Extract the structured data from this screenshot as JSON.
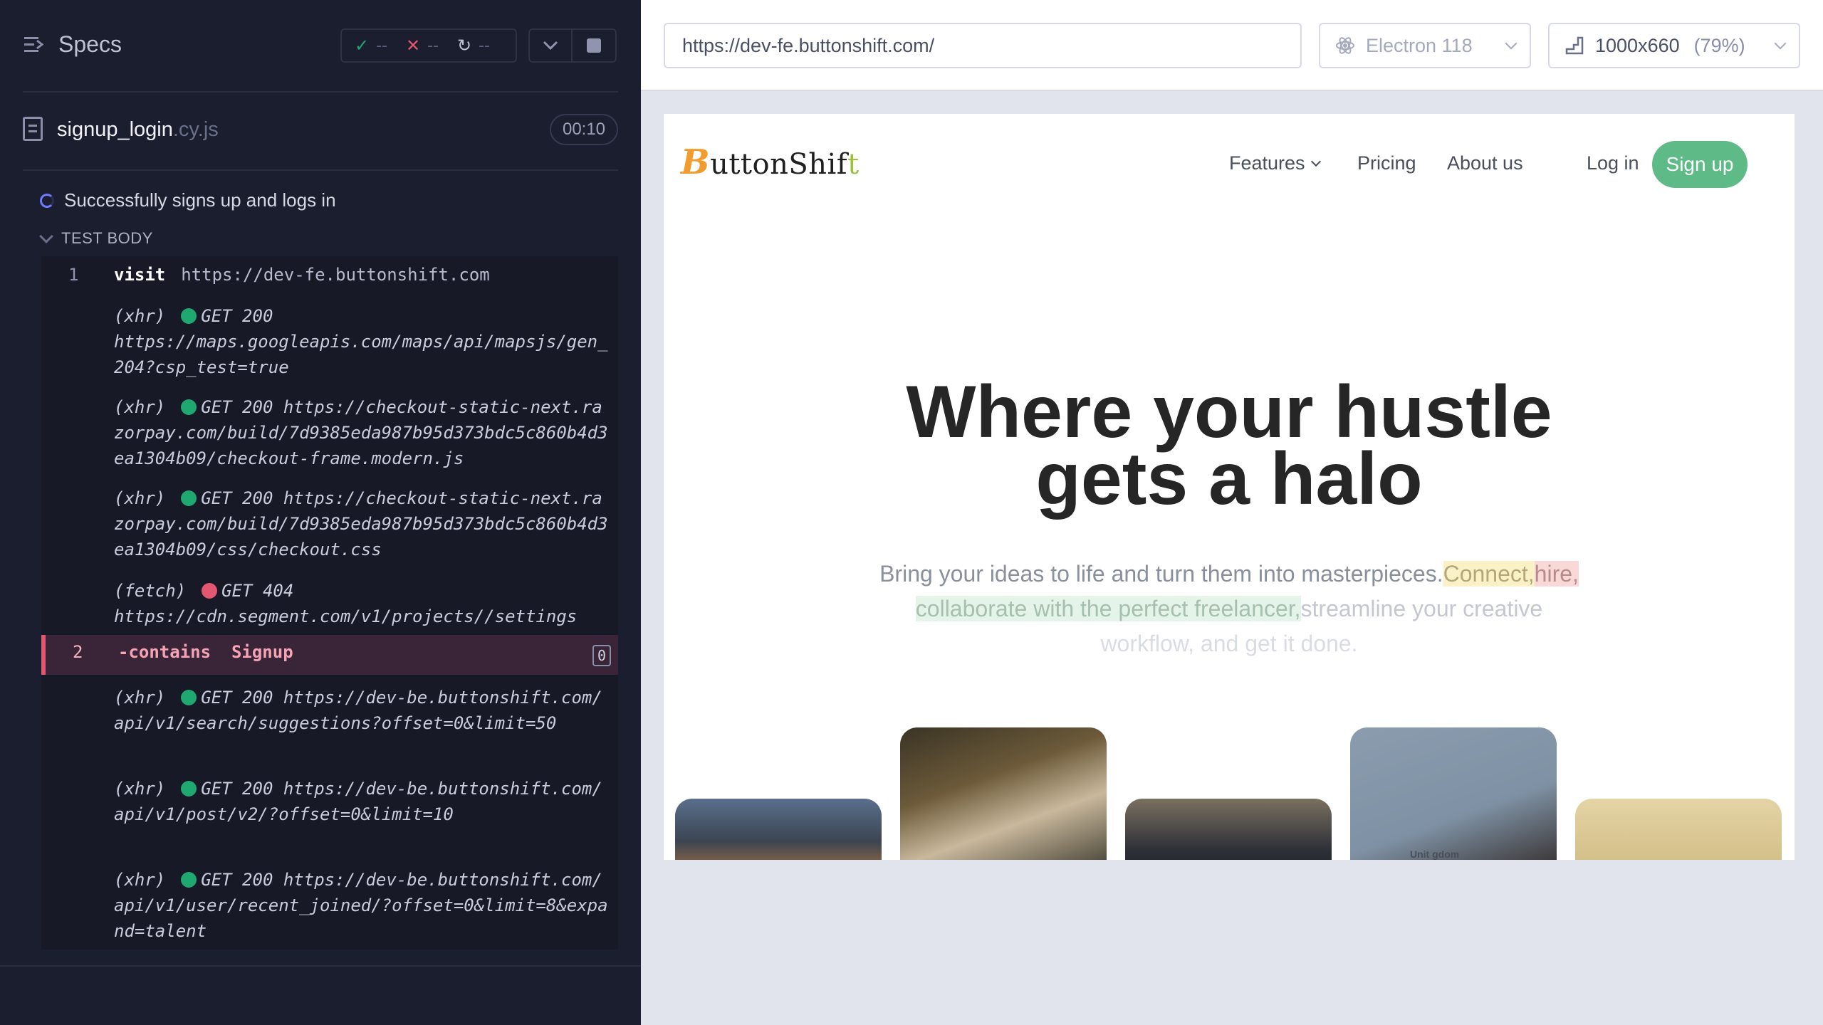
{
  "reporter": {
    "specs_label": "Specs",
    "stats": {
      "passed": "--",
      "failed": "--",
      "pending": "--"
    },
    "spec_file": {
      "name": "signup_login",
      "ext": ".cy.js",
      "duration": "00:10"
    },
    "test_title": "Successfully signs up and logs in",
    "test_body_label": "TEST BODY",
    "commands": [
      {
        "num": "1",
        "name": "visit",
        "arg": "https://dev-fe.buttonshift.com"
      },
      {
        "num": "2",
        "name": "-contains",
        "arg": "Signup",
        "count": "0"
      }
    ],
    "requests": [
      {
        "kind": "(xhr)",
        "status": "ok",
        "method": "GET 200",
        "url": "https://maps.googleapis.com/maps/api/mapsjs/gen_204?csp_test=true"
      },
      {
        "kind": "(xhr)",
        "status": "ok",
        "method": "GET 200",
        "url": "https://checkout-static-next.razorpay.com/build/7d9385eda987b95d373bdc5c860b4d3ea1304b09/checkout-frame.modern.js"
      },
      {
        "kind": "(xhr)",
        "status": "ok",
        "method": "GET 200",
        "url": "https://checkout-static-next.razorpay.com/build/7d9385eda987b95d373bdc5c860b4d3ea1304b09/css/checkout.css"
      },
      {
        "kind": "(fetch)",
        "status": "err",
        "method": "GET 404",
        "url": "https://cdn.segment.com/v1/projects//settings"
      },
      {
        "kind": "(xhr)",
        "status": "ok",
        "method": "GET 200",
        "url": "https://dev-be.buttonshift.com/api/v1/search/suggestions?offset=0&limit=50"
      },
      {
        "kind": "(xhr)",
        "status": "ok",
        "method": "GET 200",
        "url": "https://dev-be.buttonshift.com/api/v1/post/v2/?offset=0&limit=10"
      },
      {
        "kind": "(xhr)",
        "status": "ok",
        "method": "GET 200",
        "url": "https://dev-be.buttonshift.com/api/v1/user/recent_joined/?offset=0&limit=8&expand=talent"
      }
    ]
  },
  "aut": {
    "url": "https://dev-fe.buttonshift.com/",
    "browser": "Electron 118",
    "viewport": "1000x660",
    "scale": "(79%)",
    "site": {
      "logo_b": "B",
      "logo_rest": "uttonShif",
      "logo_t": "t",
      "nav": {
        "features": "Features",
        "pricing": "Pricing",
        "about": "About us",
        "login": "Log in",
        "signup": "Sign up"
      },
      "hero_title_line1": "Where your hustle",
      "hero_title_line2": "gets a halo",
      "hero_sub": {
        "part1": "Bring your ideas to life and turn them into masterpieces.",
        "connect": "Connect,",
        "hire": "hire,",
        "collab": "collaborate with the perfect freelancer,",
        "part2": "streamline your creative",
        "part3": "workflow, and get it done."
      },
      "card_label": "Unit    gdom"
    }
  },
  "colors": {
    "accent_green": "#5eba86",
    "fail_red": "#e45770",
    "pass_green": "#1fa971",
    "logo_orange": "#f29b2e"
  }
}
